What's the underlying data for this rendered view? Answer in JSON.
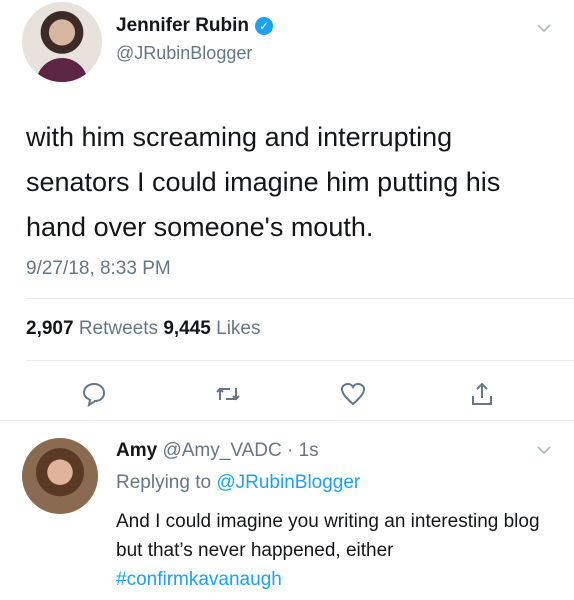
{
  "tweet": {
    "display_name": "Jennifer Rubin",
    "verified_icon": "verified-badge-icon",
    "handle": "@JRubinBlogger",
    "text": "with him screaming and interrupting senators I could imagine him putting his hand over someone's mouth.",
    "timestamp": "9/27/18, 8:33 PM",
    "retweets_count": "2,907",
    "retweets_label": "Retweets",
    "likes_count": "9,445",
    "likes_label": "Likes"
  },
  "actions": [
    "reply-icon",
    "retweet-icon",
    "like-icon",
    "share-icon"
  ],
  "reply": {
    "display_name": "Amy",
    "handle": "@Amy_VADC",
    "separator": "·",
    "time": "1s",
    "replying_prefix": "Replying to",
    "replying_to": "@JRubinBlogger",
    "text": "And I could imagine you writing an interesting blog but that’s never happened, either",
    "hashtag": "#confirmkavanaugh"
  },
  "colors": {
    "accent": "#1da1f2",
    "secondary_text": "#657786",
    "divider": "#e6ecf0"
  }
}
